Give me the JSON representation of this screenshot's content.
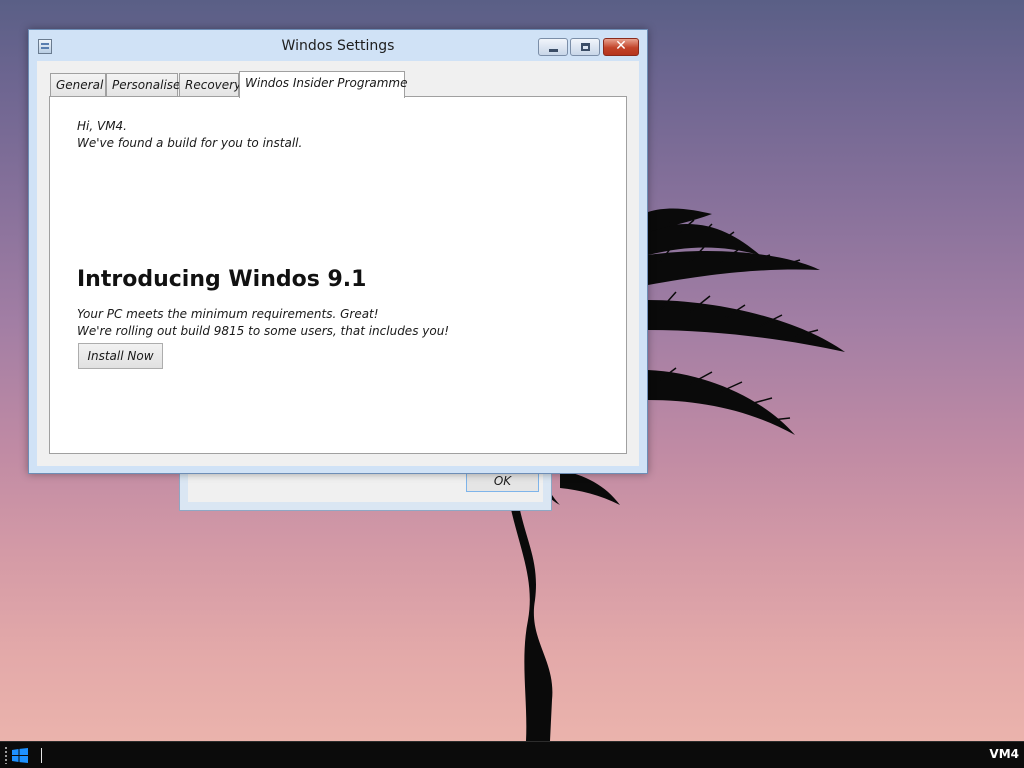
{
  "window": {
    "title": "Windos Settings",
    "close_glyph": "✕"
  },
  "tabs": [
    {
      "label": "General"
    },
    {
      "label": "Personalise"
    },
    {
      "label": "Recovery"
    },
    {
      "label": "Windos Insider Programme",
      "selected": true
    }
  ],
  "insider": {
    "greeting": "Hi, VM4.",
    "found_build": "We've found a build for you to install.",
    "headline": "Introducing Windos 9.1",
    "meets_requirements": "Your PC meets the minimum requirements. Great!",
    "rolling_out": "We're rolling out build 9815 to some users, that includes you!",
    "install_button": "Install Now"
  },
  "background_dialog": {
    "ok_button": "OK"
  },
  "taskbar": {
    "user": "VM4",
    "start_icon": "windows-logo-icon"
  },
  "colors": {
    "title_bar": "#d0e2f6",
    "close_button": "#c24329",
    "taskbar": "#0b0b0b"
  }
}
